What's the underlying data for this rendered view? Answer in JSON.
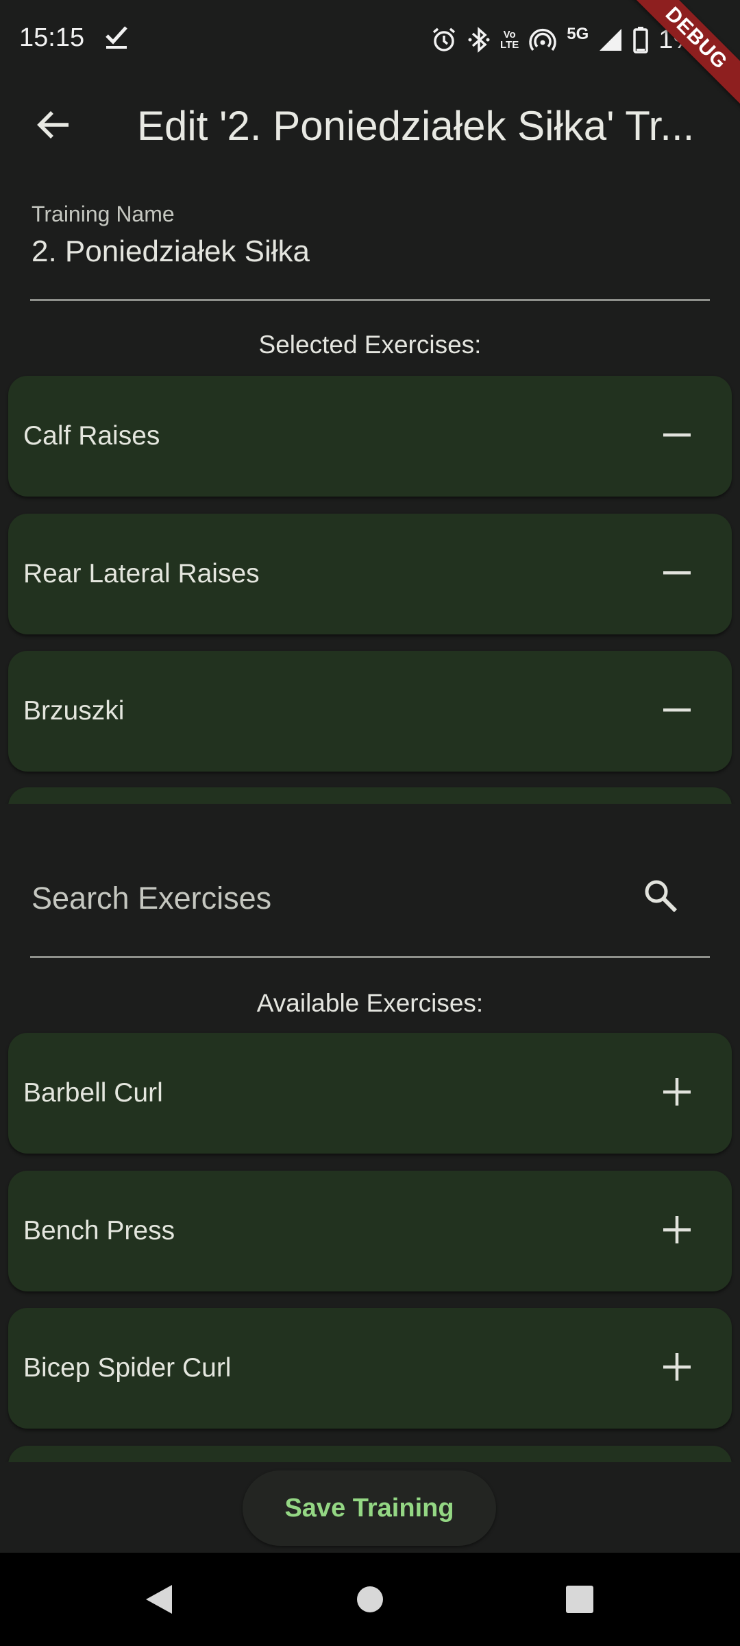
{
  "status_bar": {
    "time": "15:15",
    "network_label": "5G",
    "volte_label_top": "Vo",
    "volte_label_bottom": "LTE",
    "battery_text": "1%",
    "icons": [
      "check-icon",
      "alarm-icon",
      "bluetooth-icon",
      "volte-icon",
      "hotspot-icon",
      "signal-icon",
      "battery-icon"
    ]
  },
  "debug_banner": "DEBUG",
  "app_bar": {
    "title": "Edit '2. Poniedziałek Siłka' Tr...",
    "back_icon": "arrow-left-icon"
  },
  "training_name": {
    "label": "Training Name",
    "value": "2. Poniedziałek Siłka"
  },
  "selected": {
    "heading": "Selected Exercises:",
    "items": [
      {
        "name": "Calf Raises",
        "action_icon": "minus-icon"
      },
      {
        "name": "Rear Lateral Raises",
        "action_icon": "minus-icon"
      },
      {
        "name": "Brzuszki",
        "action_icon": "minus-icon"
      }
    ]
  },
  "search": {
    "placeholder": "Search Exercises",
    "value": "",
    "icon": "search-icon"
  },
  "available": {
    "heading": "Available Exercises:",
    "items": [
      {
        "name": "Barbell Curl",
        "action_icon": "plus-icon"
      },
      {
        "name": "Bench Press",
        "action_icon": "plus-icon"
      },
      {
        "name": "Bicep Spider Curl",
        "action_icon": "plus-icon"
      }
    ]
  },
  "save_button": {
    "label": "Save Training"
  },
  "nav_bar": {
    "icons": [
      "back-triangle-icon",
      "home-circle-icon",
      "recents-square-icon"
    ]
  },
  "colors": {
    "background": "#1c1d1c",
    "card": "#22321f",
    "accent_text": "#94d784",
    "debug_banner": "#8e1f1f"
  }
}
